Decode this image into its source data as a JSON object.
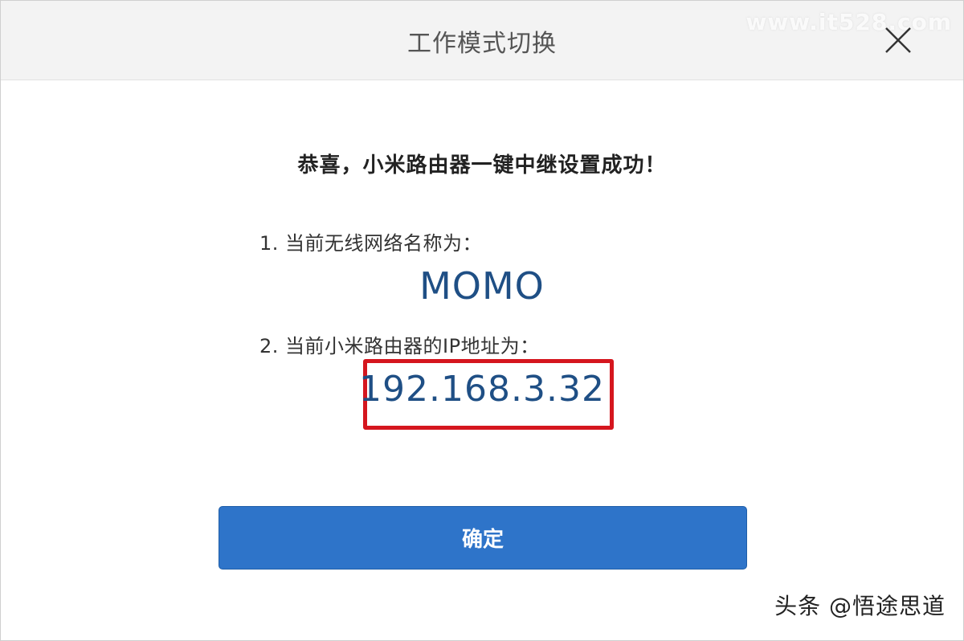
{
  "dialog": {
    "title": "工作模式切换",
    "close_icon": "close-icon"
  },
  "content": {
    "success_message": "恭喜，小米路由器一键中继设置成功！",
    "wifi_label": "1. 当前无线网络名称为：",
    "wifi_name": "MOMO",
    "ip_label": "2. 当前小米路由器的IP地址为：",
    "ip_address": "192.168.3.32",
    "highlight_color": "#d5161e",
    "value_color": "#1f4f85"
  },
  "actions": {
    "confirm_label": "确定",
    "confirm_color": "#2e74c9"
  },
  "watermarks": {
    "top": "www.it528.com",
    "bottom": "头条 @悟途思道"
  }
}
